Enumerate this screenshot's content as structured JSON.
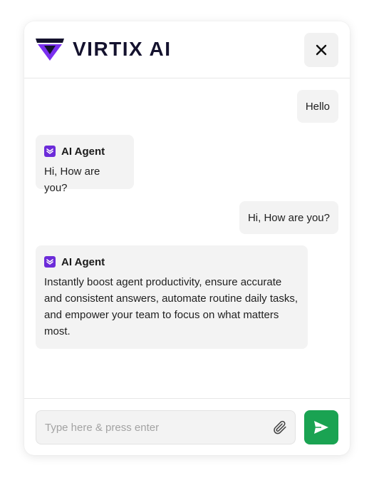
{
  "header": {
    "brand_name": "VIRTIX AI",
    "logo_icon": "virtix-logo",
    "close_icon": "close-icon",
    "brand_color": "#6c2bd9",
    "brand_text_color": "#14122e"
  },
  "messages": [
    {
      "role": "user",
      "text": "Hello"
    },
    {
      "role": "agent",
      "sender": "AI Agent",
      "text": "Hi, How are you?"
    },
    {
      "role": "user",
      "text": "Hi, How are you?"
    },
    {
      "role": "agent",
      "sender": "AI Agent",
      "text": "Instantly boost agent productivity, ensure accurate and consistent answers, automate routine daily tasks, and empower your team to focus on what matters most."
    }
  ],
  "composer": {
    "placeholder": "Type here & press enter",
    "value": "",
    "attach_icon": "paperclip-icon",
    "send_icon": "send-icon",
    "send_color": "#1aa352"
  }
}
